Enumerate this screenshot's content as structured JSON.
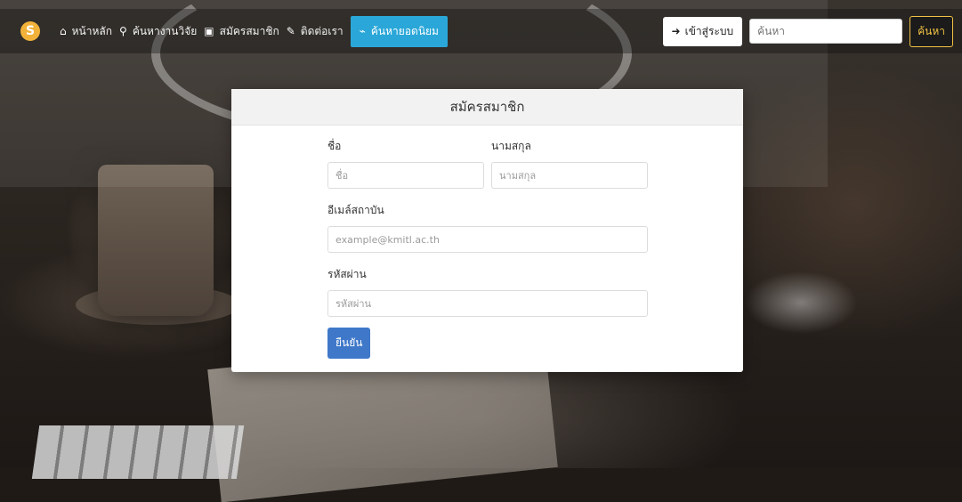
{
  "navbar": {
    "brand_letter": "S",
    "items": [
      {
        "icon": "home-icon",
        "glyph": "⌂",
        "label": "หน้าหลัก"
      },
      {
        "icon": "search-icon",
        "glyph": "⚲",
        "label": "ค้นหางานวิจัย"
      },
      {
        "icon": "id-card-icon",
        "glyph": "▣",
        "label": "สมัครสมาชิก"
      },
      {
        "icon": "edit-icon",
        "glyph": "✎",
        "label": "ติดต่อเรา"
      },
      {
        "icon": "chart-icon",
        "glyph": "⌁",
        "label": "ค้นหายอดนิยม"
      }
    ],
    "login_label": "เข้าสู่ระบบ",
    "search_placeholder": "ค้นหา",
    "search_button": "ค้นหา"
  },
  "form": {
    "title": "สมัครสมาชิก",
    "first_name_label": "ชื่อ",
    "first_name_placeholder": "ชื่อ",
    "last_name_label": "นามสกุล",
    "last_name_placeholder": "นามสกุล",
    "email_label": "อีเมล์สถาบัน",
    "email_placeholder": "example@kmitl.ac.th",
    "password_label": "รหัสผ่าน",
    "password_placeholder": "รหัสผ่าน",
    "submit_label": "ยืนยัน"
  },
  "colors": {
    "accent": "#2aa7d8",
    "brand": "#f2b23a",
    "submit": "#3f78c9",
    "search_button": "#f1c244"
  }
}
